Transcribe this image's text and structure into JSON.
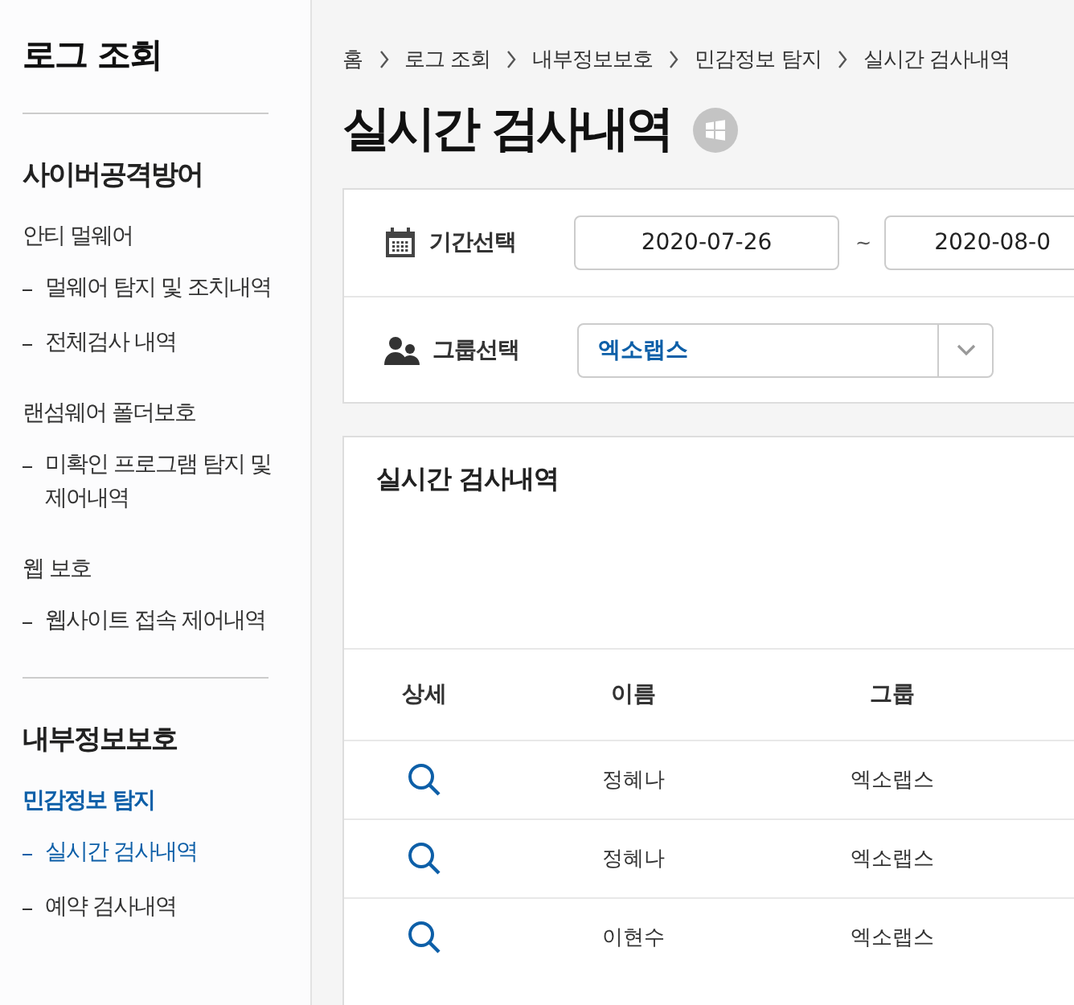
{
  "sidebar": {
    "title": "로그 조회",
    "sections": [
      {
        "title": "사이버공격방어",
        "groups": [
          {
            "label": "안티 멀웨어",
            "selected": false,
            "items": [
              {
                "label": "멀웨어 탐지 및 조치내역",
                "selected": false
              },
              {
                "label": "전체검사 내역",
                "selected": false
              }
            ]
          },
          {
            "label": "랜섬웨어 폴더보호",
            "selected": false,
            "items": [
              {
                "label": "미확인 프로그램 탐지 및 제어내역",
                "selected": false
              }
            ]
          },
          {
            "label": "웹 보호",
            "selected": false,
            "items": [
              {
                "label": "웹사이트 접속 제어내역",
                "selected": false
              }
            ]
          }
        ]
      },
      {
        "title": "내부정보보호",
        "groups": [
          {
            "label": "민감정보 탐지",
            "selected": true,
            "items": [
              {
                "label": "실시간 검사내역",
                "selected": true
              },
              {
                "label": "예약 검사내역",
                "selected": false
              }
            ]
          }
        ]
      }
    ]
  },
  "breadcrumb": [
    "홈",
    "로그 조회",
    "내부정보보호",
    "민감정보 탐지",
    "실시간 검사내역"
  ],
  "page_title": "실시간 검사내역",
  "filters": {
    "period": {
      "label": "기간선택",
      "from": "2020-07-26",
      "separator": "~",
      "to": "2020-08-0"
    },
    "group": {
      "label": "그룹선택",
      "value": "엑소랩스"
    }
  },
  "results": {
    "title": "실시간 검사내역",
    "columns": [
      "상세",
      "이름",
      "그룹"
    ],
    "rows": [
      {
        "name": "정혜나",
        "group": "엑소랩스"
      },
      {
        "name": "정혜나",
        "group": "엑소랩스"
      },
      {
        "name": "이현수",
        "group": "엑소랩스"
      }
    ]
  }
}
